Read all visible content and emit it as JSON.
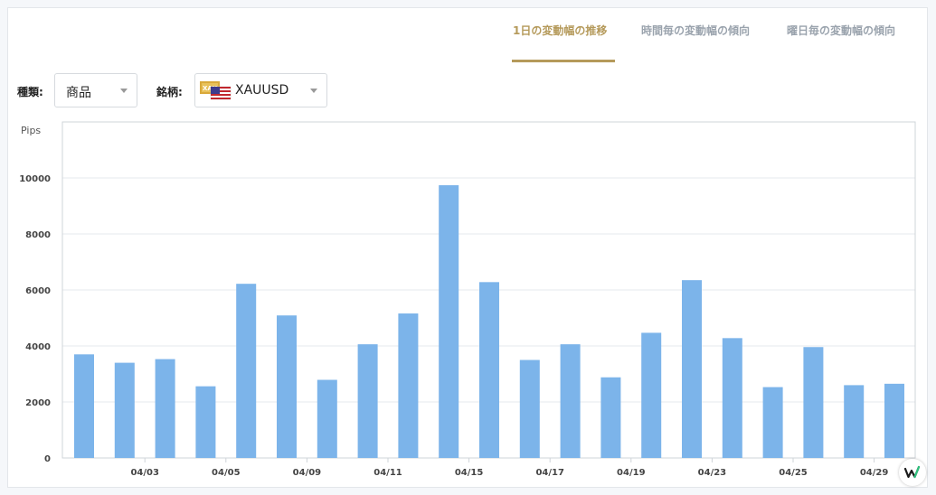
{
  "tabs": [
    {
      "label": "1日の変動幅の推移",
      "active": true
    },
    {
      "label": "時間毎の変動幅の傾向",
      "active": false
    },
    {
      "label": "曜日毎の変動幅の傾向",
      "active": false
    }
  ],
  "filters": {
    "type_label": "種類:",
    "type_value": "商品",
    "symbol_label": "銘柄:",
    "symbol_value": "XAUUSD",
    "symbol_flag_text": "XAU"
  },
  "colors": {
    "accent": "#b59a5b",
    "bar": "#7cb4ea",
    "tab_inactive": "#9aa3ad"
  },
  "icons": [
    "caret-down-icon",
    "gold-bar-icon",
    "us-flag-icon",
    "brand-logo-icon"
  ],
  "chart_data": {
    "type": "bar",
    "ylabel": "Pips",
    "ylim": [
      0,
      12000
    ],
    "yticks": [
      0,
      2000,
      4000,
      6000,
      8000,
      10000
    ],
    "grid": true,
    "x_tick_labels": [
      "04/03",
      "04/05",
      "04/09",
      "04/11",
      "04/15",
      "04/17",
      "04/19",
      "04/23",
      "04/25",
      "04/29"
    ],
    "x_tick_after_bar": [
      1,
      3,
      5,
      7,
      9,
      11,
      13,
      15,
      17,
      19
    ],
    "values": [
      3700,
      3400,
      3530,
      2560,
      6220,
      5090,
      2790,
      4060,
      5160,
      9740,
      6280,
      3500,
      4060,
      2880,
      4470,
      6350,
      4280,
      2530,
      3960,
      2600,
      2650
    ]
  }
}
